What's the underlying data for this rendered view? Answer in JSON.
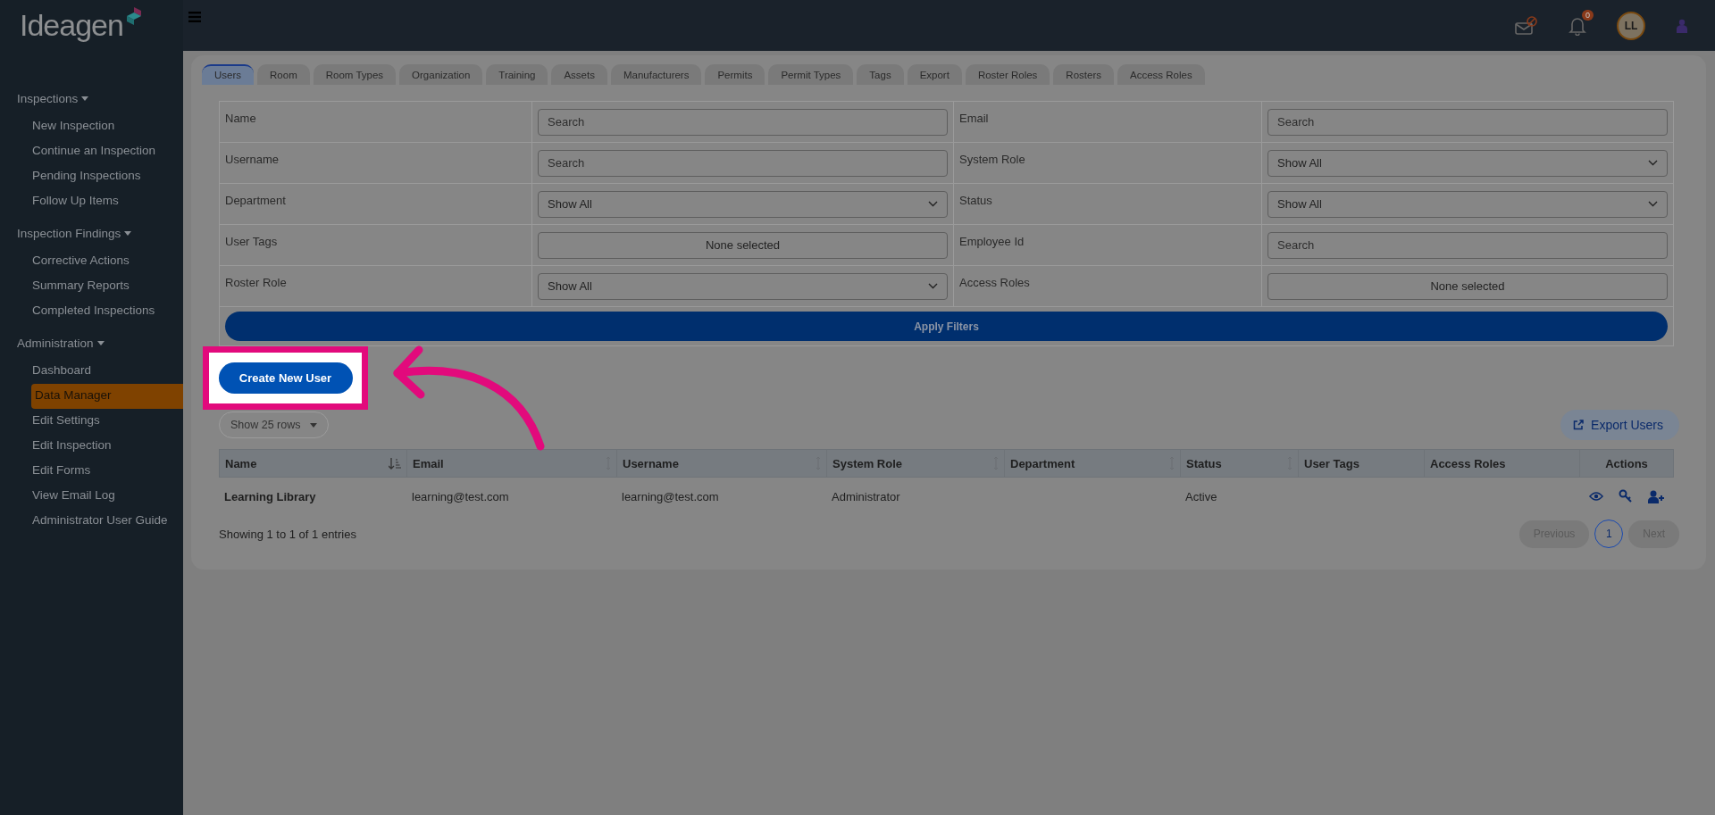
{
  "brand": {
    "name": "Ideagen"
  },
  "header": {
    "notification_count": "0",
    "avatar_initials": "LL"
  },
  "sidebar": {
    "groups": [
      {
        "title": "Inspections",
        "items": [
          {
            "label": "New Inspection",
            "selected": false
          },
          {
            "label": "Continue an Inspection",
            "selected": false
          },
          {
            "label": "Pending Inspections",
            "selected": false
          },
          {
            "label": "Follow Up Items",
            "selected": false
          }
        ]
      },
      {
        "title": "Inspection Findings",
        "items": [
          {
            "label": "Corrective Actions",
            "selected": false
          },
          {
            "label": "Summary Reports",
            "selected": false
          },
          {
            "label": "Completed Inspections",
            "selected": false
          }
        ]
      },
      {
        "title": "Administration",
        "items": [
          {
            "label": "Dashboard",
            "selected": false
          },
          {
            "label": "Data Manager",
            "selected": true
          },
          {
            "label": "Edit Settings",
            "selected": false
          },
          {
            "label": "Edit Inspection",
            "selected": false
          },
          {
            "label": "Edit Forms",
            "selected": false
          },
          {
            "label": "View Email Log",
            "selected": false
          },
          {
            "label": "Administrator User Guide",
            "selected": false
          }
        ]
      }
    ]
  },
  "tabs": [
    {
      "label": "Users",
      "selected": true
    },
    {
      "label": "Room",
      "selected": false
    },
    {
      "label": "Room Types",
      "selected": false
    },
    {
      "label": "Organization",
      "selected": false
    },
    {
      "label": "Training",
      "selected": false
    },
    {
      "label": "Assets",
      "selected": false
    },
    {
      "label": "Manufacturers",
      "selected": false
    },
    {
      "label": "Permits",
      "selected": false
    },
    {
      "label": "Permit Types",
      "selected": false
    },
    {
      "label": "Tags",
      "selected": false
    },
    {
      "label": "Export",
      "selected": false
    },
    {
      "label": "Roster Roles",
      "selected": false
    },
    {
      "label": "Rosters",
      "selected": false
    },
    {
      "label": "Access Roles",
      "selected": false
    }
  ],
  "filters": [
    {
      "label": "Name",
      "kind": "text",
      "placeholder": "Search"
    },
    {
      "label": "Email",
      "kind": "text",
      "placeholder": "Search"
    },
    {
      "label": "Username",
      "kind": "text",
      "placeholder": "Search"
    },
    {
      "label": "System Role",
      "kind": "select",
      "value": "Show All"
    },
    {
      "label": "Department",
      "kind": "select",
      "value": "Show All"
    },
    {
      "label": "Status",
      "kind": "select",
      "value": "Show All"
    },
    {
      "label": "User Tags",
      "kind": "multi",
      "value": "None selected"
    },
    {
      "label": "Employee Id",
      "kind": "text",
      "placeholder": "Search"
    },
    {
      "label": "Roster Role",
      "kind": "select",
      "value": "Show All"
    },
    {
      "label": "Access Roles",
      "kind": "multi",
      "value": "None selected"
    }
  ],
  "apply_button": "Apply Filters",
  "create_button": {
    "label": "Create New User",
    "highlighted": true
  },
  "rows_select": "Show 25 rows",
  "export_button": "Export Users",
  "table": {
    "columns": [
      {
        "label": "Name",
        "kind": "sorted"
      },
      {
        "label": "Email",
        "kind": "sortable"
      },
      {
        "label": "Username",
        "kind": "sortable"
      },
      {
        "label": "System Role",
        "kind": "sortable"
      },
      {
        "label": "Department",
        "kind": "sortable"
      },
      {
        "label": "Status",
        "kind": "sortable"
      },
      {
        "label": "User Tags",
        "kind": "plain"
      },
      {
        "label": "Access Roles",
        "kind": "plain"
      },
      {
        "label": "Actions",
        "kind": "plain"
      }
    ],
    "rows": [
      {
        "cells": [
          "Learning Library",
          "learning@test.com",
          "learning@test.com",
          "Administrator",
          "",
          "Active",
          "",
          ""
        ]
      }
    ]
  },
  "footer": {
    "summary": "Showing 1 to 1 of 1 entries",
    "previous": "Previous",
    "pages": [
      {
        "label": "1",
        "selected": true
      }
    ],
    "next": "Next"
  }
}
